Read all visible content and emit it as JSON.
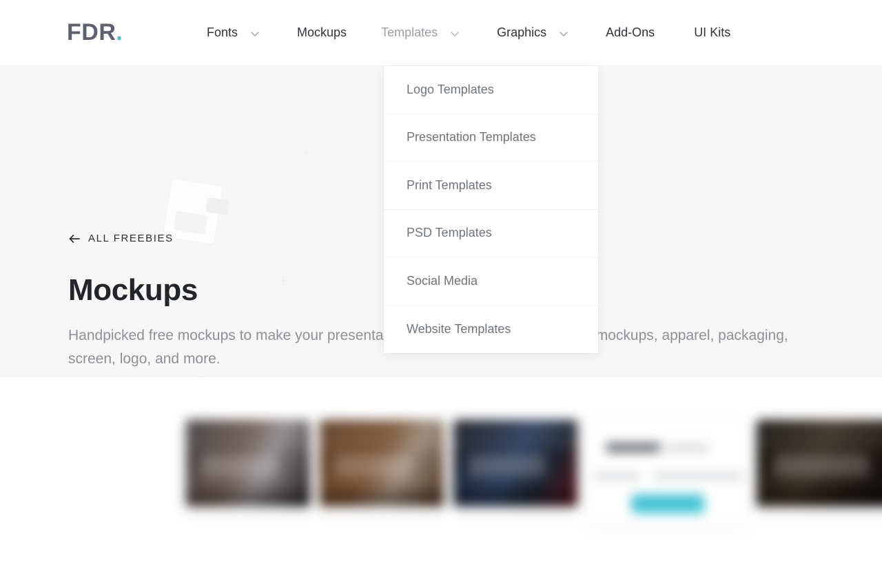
{
  "header": {
    "logo": {
      "text": "FDR",
      "dot": ".",
      "color": "#5a6170",
      "dot_color": "#3fc6c0"
    },
    "nav": [
      {
        "label": "Fonts",
        "has_chevron": true,
        "active": false
      },
      {
        "label": "Mockups",
        "has_chevron": false,
        "active": false
      },
      {
        "label": "Templates",
        "has_chevron": true,
        "active": true
      },
      {
        "label": "Graphics",
        "has_chevron": true,
        "active": false
      },
      {
        "label": "Add-Ons",
        "has_chevron": false,
        "active": false
      },
      {
        "label": "UI Kits",
        "has_chevron": false,
        "active": false
      }
    ]
  },
  "dropdown": {
    "open_for": "Templates",
    "items": [
      {
        "label": "Logo Templates"
      },
      {
        "label": "Presentation Templates"
      },
      {
        "label": "Print Templates"
      },
      {
        "label": "PSD Templates"
      },
      {
        "label": "Social Media"
      },
      {
        "label": "Website Templates"
      }
    ]
  },
  "hero": {
    "back_link": "ALL FREEBIES",
    "back_arrow": "←",
    "title": "Mockups",
    "description": "Handpicked free mockups to make your presentation stand out, ranging from print mockups, apparel, packaging, screen, logo, and more.",
    "background_color": "#f7f7f7"
  },
  "gallery": {
    "cards": [
      {
        "name": "mockup-thumbnail-1",
        "type": "image"
      },
      {
        "name": "mockup-thumbnail-2",
        "type": "image"
      },
      {
        "name": "mockup-thumbnail-3",
        "type": "image"
      },
      {
        "name": "promo-card",
        "type": "promo",
        "button_color": "#45c4d2"
      },
      {
        "name": "mockup-thumbnail-4",
        "type": "image"
      }
    ]
  }
}
